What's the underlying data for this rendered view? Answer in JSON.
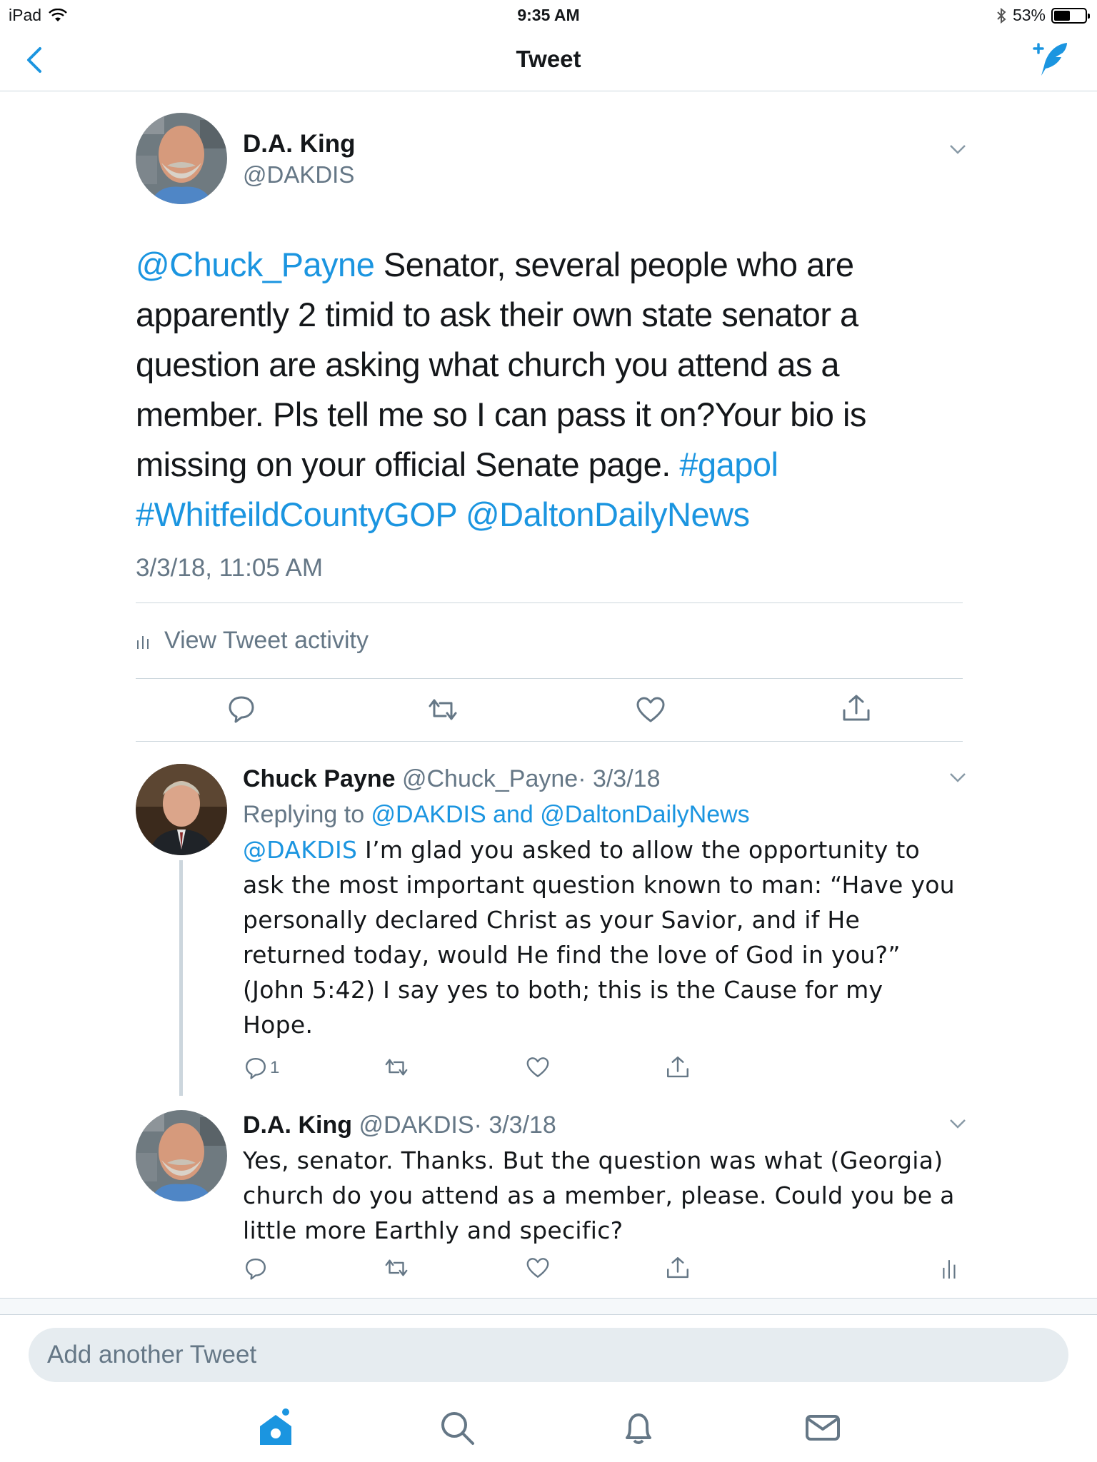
{
  "status_bar": {
    "device": "iPad",
    "time": "9:35 AM",
    "battery": "53%",
    "battery_level": 0.53
  },
  "nav": {
    "title": "Tweet",
    "back_icon": "chevron-left-icon",
    "compose_icon": "compose-tweet-icon"
  },
  "main_tweet": {
    "name": "D.A. King",
    "handle": "@DAKDIS",
    "text_parts": {
      "mention": "@Chuck_Payne",
      "text1": " Senator, several people who are apparently 2 timid to ask their own state senator a question are asking what church you attend as a member. Pls tell me so I can pass it on?Your bio is missing on your official Senate page. ",
      "hashtag1": "#gapol",
      "hashtag2": "#WhitfeildCountyGOP",
      "mention2": "@DaltonDailyNews"
    },
    "date": "3/3/18, 11:05 AM",
    "activity_label": "View Tweet activity"
  },
  "reply1": {
    "name": "Chuck Payne",
    "handle": "@Chuck_Payne",
    "date": "· 3/3/18",
    "replying_prefix": "Replying to ",
    "replying_to1": "@DAKDIS",
    "replying_and": " and ",
    "replying_to2": "@DaltonDailyNews",
    "mention": "@DAKDIS",
    "text": " I’m glad you asked to allow the opportunity to ask the most important question known to man: “Have you personally declared Christ as your Savior, and if He returned today, would He find the love of God in you?” (John 5:42) I say yes to both; this is the Cause for my Hope.",
    "reply_count": "1"
  },
  "reply2": {
    "name": "D.A. King",
    "handle": "@DAKDIS",
    "date": "· 3/3/18",
    "text": "Yes, senator. Thanks. But the question was what (Georgia) church do you attend as a member, please. Could you be a little more Earthly and specific?"
  },
  "composer": {
    "placeholder": "Add another Tweet"
  },
  "colors": {
    "accent": "#1b95e0",
    "text": "#14171a",
    "secondary": "#657786",
    "divider": "#ccd6dd"
  }
}
